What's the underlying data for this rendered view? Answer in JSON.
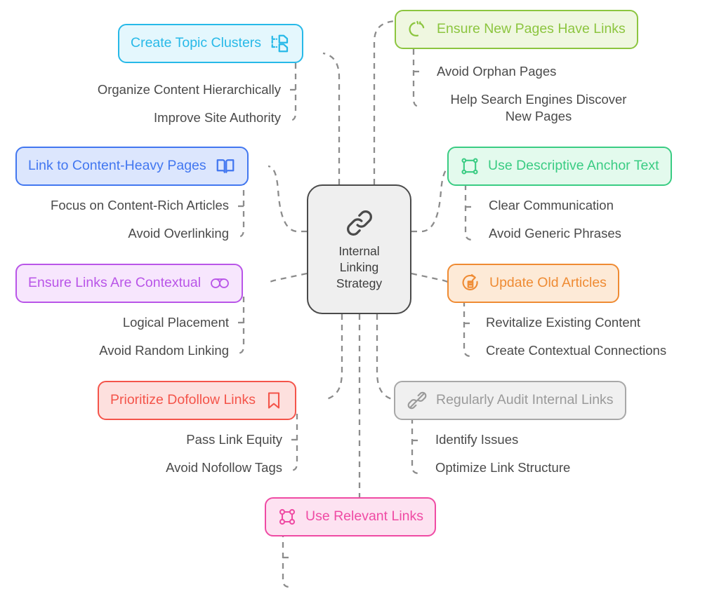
{
  "diagram": {
    "type": "mind-map",
    "title": "Internal Linking Strategy",
    "center": {
      "label": "Internal\nLinking\nStrategy",
      "icon": "link-chain-icon",
      "fill": "#efefef",
      "border": "#4a4a4a",
      "text_color": "#3d3d3d"
    },
    "branches": [
      {
        "id": "create-topic-clusters",
        "label": "Create Topic Clusters",
        "icon": "sitemap-icon",
        "icon_side": "right",
        "color": "#27b9e8",
        "fill": "#e4f7fd",
        "side": "left",
        "children": [
          "Organize Content Hierarchically",
          "Improve Site Authority"
        ]
      },
      {
        "id": "link-to-content-heavy-pages",
        "label": "Link to Content-Heavy Pages",
        "icon": "open-book-icon",
        "icon_side": "right",
        "color": "#4277f0",
        "fill": "#dce6fd",
        "side": "left",
        "children": [
          "Focus on Content-Rich Articles",
          "Avoid Overlinking"
        ]
      },
      {
        "id": "ensure-links-are-contextual",
        "label": "Ensure Links Are Contextual",
        "icon": "infinity-link-icon",
        "icon_side": "right",
        "color": "#b champion"
      },
      {
        "id": "prioritize-dofollow-links",
        "label": "Prioritize Dofollow Links",
        "icon": "bookmark-icon",
        "icon_side": "right",
        "color": "#f4544a",
        "fill": "#fde0de",
        "side": "left",
        "children": [
          "Pass Link Equity",
          "Avoid Nofollow Tags"
        ]
      },
      {
        "id": "use-relevant-links",
        "label": "Use Relevant Links",
        "icon": "command-key-icon",
        "icon_side": "left",
        "color": "#ef4ba4",
        "fill": "#fde2f1",
        "side": "bottom",
        "children": []
      },
      {
        "id": "ensure-new-pages-have-links",
        "label": "Ensure New Pages Have Links",
        "icon": "sparkle-loader-icon",
        "icon_side": "left",
        "color": "#8cc53f",
        "fill": "#eff7e0",
        "side": "right",
        "children": [
          "Avoid Orphan Pages",
          "Help Search Engines Discover\nNew Pages"
        ]
      },
      {
        "id": "use-descriptive-anchor-text",
        "label": "Use Descriptive Anchor Text",
        "icon": "selection-box-icon",
        "icon_side": "left",
        "color": "#3acc83",
        "fill": "#e3faed",
        "side": "right",
        "children": [
          "Clear Communication",
          "Avoid Generic Phrases"
        ]
      },
      {
        "id": "update-old-articles",
        "label": "Update Old Articles",
        "icon": "refresh-history-icon",
        "icon_side": "left",
        "color": "#ef8b33",
        "fill": "#fdead7",
        "side": "right",
        "children": [
          "Revitalize Existing Content",
          "Create Contextual Connections"
        ]
      },
      {
        "id": "regularly-audit-internal-links",
        "label": "Regularly Audit Internal Links",
        "icon": "broken-link-icon",
        "icon_side": "left",
        "color": "#9a9a9a",
        "fill": "#f0f0f0",
        "side": "right",
        "children": [
          "Identify Issues",
          "Optimize Link Structure"
        ]
      }
    ],
    "nodes": {
      "topic_clusters": {
        "label": "Create Topic Clusters",
        "child_1": "Organize Content Hierarchically",
        "child_2": "Improve Site Authority"
      },
      "content_heavy": {
        "label": "Link to Content-Heavy Pages",
        "child_1": "Focus on Content-Rich Articles",
        "child_2": "Avoid Overlinking"
      },
      "contextual": {
        "label": "Ensure Links Are Contextual",
        "child_1": "Logical Placement",
        "child_2": "Avoid Random Linking"
      },
      "dofollow": {
        "label": "Prioritize Dofollow Links",
        "child_1": "Pass Link Equity",
        "child_2": "Avoid Nofollow Tags"
      },
      "relevant": {
        "label": "Use Relevant Links"
      },
      "new_pages": {
        "label": "Ensure New Pages Have Links",
        "child_1": "Avoid Orphan Pages",
        "child_2": "Help Search Engines Discover\nNew Pages"
      },
      "anchor_text": {
        "label": "Use Descriptive Anchor Text",
        "child_1": "Clear Communication",
        "child_2": "Avoid Generic Phrases"
      },
      "update_old": {
        "label": "Update Old Articles",
        "child_1": "Revitalize Existing Content",
        "child_2": "Create Contextual Connections"
      },
      "audit": {
        "label": "Regularly Audit Internal Links",
        "child_1": "Identify Issues",
        "child_2": "Optimize Link Structure"
      }
    },
    "colors": {
      "connector": "#8c8c8c",
      "sub_text": "#4a4a4a",
      "cyan": "#27b9e8",
      "blue": "#4277f0",
      "purple": "#b955e8",
      "red": "#f4544a",
      "pink": "#ef4ba4",
      "lime": "#8cc53f",
      "green": "#3acc83",
      "orange": "#ef8b33",
      "gray": "#9a9a9a"
    }
  }
}
